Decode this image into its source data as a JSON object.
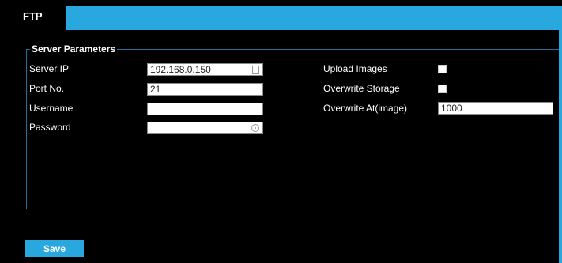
{
  "tabs": [
    {
      "label": "FTP"
    }
  ],
  "section": {
    "title": "Server Parameters"
  },
  "left_fields": {
    "server_ip": {
      "label": "Server IP",
      "value": "192.168.0.150"
    },
    "port": {
      "label": "Port No.",
      "value": "21"
    },
    "username": {
      "label": "Username",
      "value": ""
    },
    "password": {
      "label": "Password",
      "value": ""
    }
  },
  "right_fields": {
    "upload_images": {
      "label": "Upload Images",
      "checked": false
    },
    "overwrite_storage": {
      "label": "Overwrite Storage",
      "checked": false
    },
    "overwrite_at": {
      "label": "Overwrite At(image)",
      "value": "1000"
    }
  },
  "actions": {
    "save_label": "Save"
  },
  "colors": {
    "accent": "#29a8e0",
    "background": "#000000",
    "border": "#1f6fa0"
  }
}
